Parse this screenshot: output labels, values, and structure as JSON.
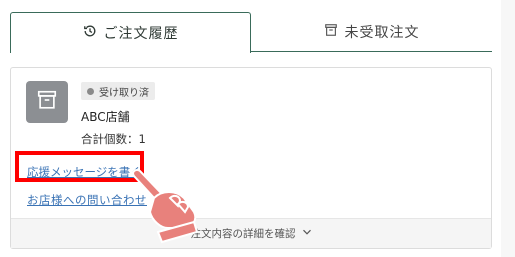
{
  "tabs": {
    "history_label": "ご注文履歴",
    "unreceived_label": "未受取注文",
    "history_icon": "history-icon",
    "unreceived_icon": "archive-box-icon"
  },
  "order": {
    "thumbnail_icon": "archive-box-icon",
    "status_badge": "受け取り済",
    "store_name": "ABC店舗",
    "total_count": "合計個数：1",
    "cheer_link": "応援メッセージを書く",
    "contact_link": "お店様への問い合わせ",
    "detail_label": "注文内容の詳細を確認"
  },
  "annotation": {
    "highlight_color": "#ff0000",
    "hand_color": "#e8817c",
    "hand_icon": "pointing-hand-icon"
  },
  "colors": {
    "tab_border": "#3a6b5a",
    "link": "#3a73b5"
  }
}
